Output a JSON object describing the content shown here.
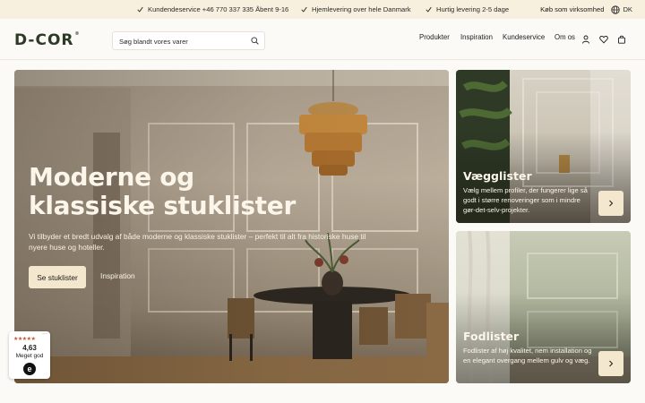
{
  "topbar": {
    "usps": [
      "Kundendeservice +46 770 337 335 Åbent 9-16",
      "Hjemlevering over hele Danmark",
      "Hurtig levering 2-5 dage"
    ],
    "business_link": "Køb som virksomhed",
    "language": "DK"
  },
  "header": {
    "logo": "D-COR",
    "logo_mark": "®",
    "search_placeholder": "Søg blandt vores varer",
    "nav": [
      "Produkter",
      "Inspiration",
      "Kundeservice",
      "Om os"
    ],
    "icons": [
      "user-icon",
      "heart-icon",
      "bag-icon"
    ]
  },
  "hero": {
    "title": "Moderne og klassiske stuklister",
    "description": "Vi tilbyder et bredt udvalg af både moderne og klassiske stuklister – perfekt til alt fra historiske huse til nyere huse og hoteller.",
    "primary_button": "Se stuklister",
    "secondary_link": "Inspiration"
  },
  "cards": [
    {
      "title": "Vægglister",
      "text": "Vælg mellem profiler, der fungerer lige så godt i større renoveringer som i mindre gør-det-selv-projekter."
    },
    {
      "title": "Fodlister",
      "text": "Fodlister af høj kvalitet, nem installation og en elegant overgang mellem gulv og væg."
    }
  ],
  "rating": {
    "stars": "★★★★★",
    "more": "···",
    "score": "4,63",
    "label": "Meget god",
    "badge": "e"
  },
  "colors": {
    "topbar_bg": "#f7f0df",
    "page_bg": "#fcfaf6",
    "logo": "#2c3a26",
    "button_bg": "#f3e7cd",
    "star": "#c4572d"
  }
}
